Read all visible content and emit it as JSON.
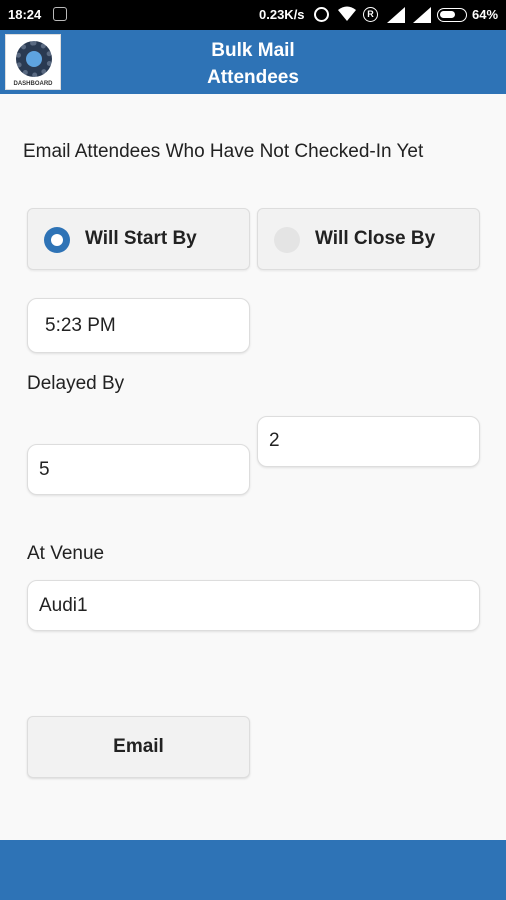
{
  "status_bar": {
    "time": "18:24",
    "speed": "0.23K/s",
    "battery": "64%",
    "battery_level": 0.64
  },
  "header": {
    "logo_text": "DASHBOARD",
    "title_line1": "Bulk Mail",
    "title_line2": "Attendees"
  },
  "form": {
    "instruction": "Email Attendees Who Have Not Checked-In Yet",
    "options": [
      {
        "label": "Will Start By",
        "selected": true
      },
      {
        "label": "Will Close By",
        "selected": false
      }
    ],
    "time_value": "5:23 PM",
    "delayed_label": "Delayed By",
    "delay_value_1": "5",
    "delay_value_2": "2",
    "venue_label": "At Venue",
    "venue_value": "Audi1",
    "email_button": "Email"
  },
  "colors": {
    "accent": "#2e73b6",
    "background": "#f9f9f9"
  }
}
